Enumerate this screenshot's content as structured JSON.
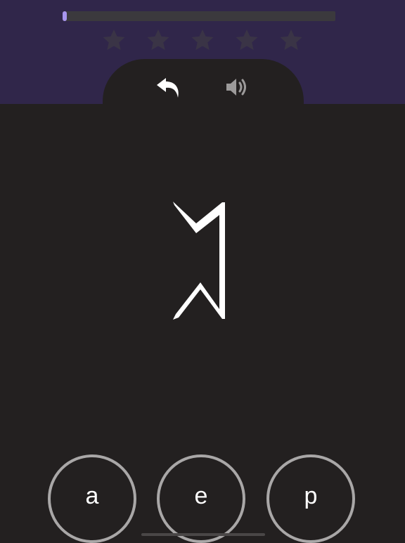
{
  "progress": {
    "value": 0.015,
    "fill_color": "#a895ee"
  },
  "rating": {
    "stars_filled": 0,
    "stars_total": 5,
    "empty_color": "#3a3446"
  },
  "toolbar": {
    "back_icon": "undo-arrow-icon",
    "sound_icon": "speaker-icon"
  },
  "quiz": {
    "glyph_icon": "rune-glyph-icon",
    "answers": [
      {
        "label": "a"
      },
      {
        "label": "e"
      },
      {
        "label": "p"
      }
    ]
  },
  "colors": {
    "header_bg": "#30264a",
    "body_bg": "#232020",
    "ring": "#a9a7a7"
  }
}
